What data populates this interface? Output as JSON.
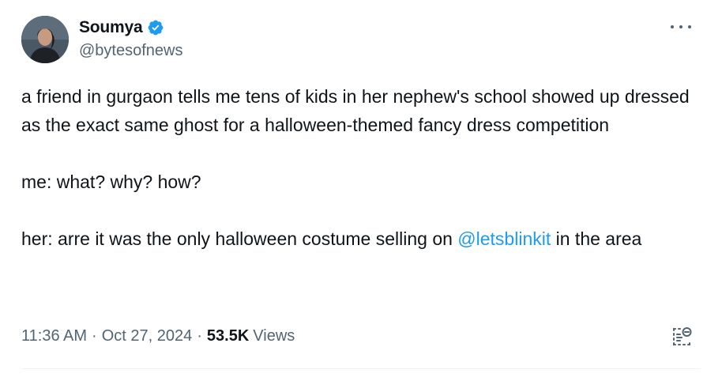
{
  "author": {
    "display_name": "Soumya",
    "handle": "@bytesofnews",
    "verified": true,
    "verified_color": "#1d9bf0"
  },
  "tweet": {
    "paragraph1": "a friend in gurgaon tells me tens of kids in her nephew's school showed up dressed as the exact same ghost for a halloween-themed fancy dress competition",
    "paragraph2": "me: what? why? how?",
    "paragraph3_before": "her: arre it was the only halloween costume selling on ",
    "paragraph3_mention": "@letsblinkit",
    "paragraph3_after": " in the area"
  },
  "meta": {
    "time": "11:36 AM",
    "separator": "·",
    "date": "Oct 27, 2024",
    "views_count": "53.5K",
    "views_label": "Views"
  },
  "icons": {
    "more": "more-options-icon",
    "grok": "grok-analyze-icon",
    "verified": "verified-badge-icon"
  },
  "colors": {
    "text": "#0f1419",
    "secondary": "#536471",
    "link": "#1d9bf0"
  }
}
